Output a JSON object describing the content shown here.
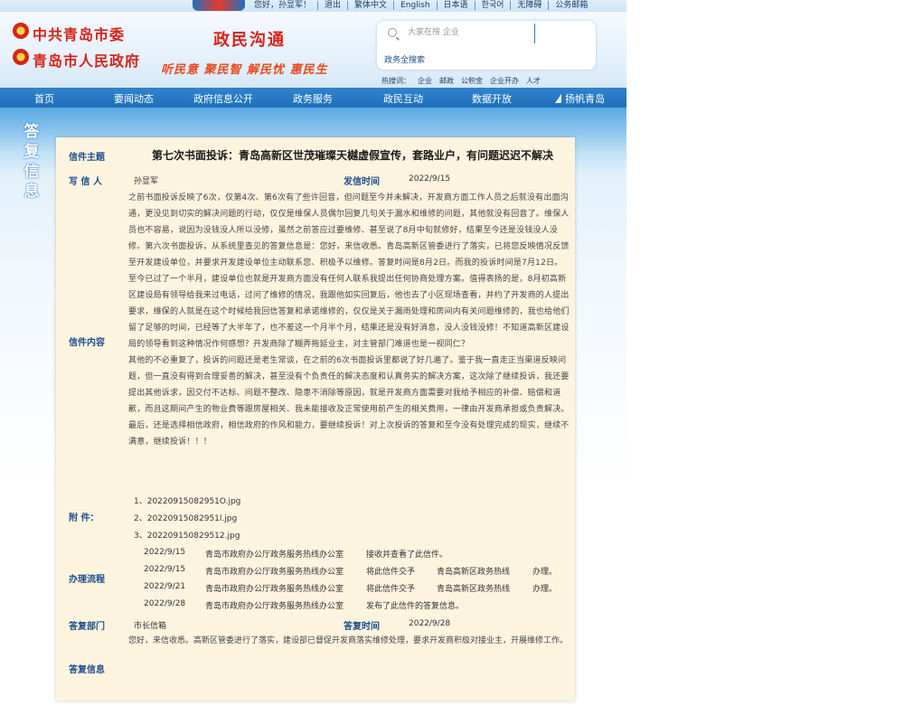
{
  "topbar": {
    "links": [
      "您好，孙显军！",
      "退出",
      "繁体中文",
      "English",
      "日本语",
      "한국어",
      "无障碍",
      "公务邮箱"
    ]
  },
  "header": {
    "party": "中共青岛市委",
    "gov": "青岛市人民政府",
    "slogan_main": "政民沟通",
    "slogan_sub": "听民意 聚民智 解民忧 惠民生",
    "search_placeholder": "大家在搜 企业",
    "search_scope": "政务全搜索",
    "hotwords_label": "热搜词：",
    "hotwords": [
      "企业",
      "邮政",
      "公积金",
      "企业开办",
      "人才"
    ]
  },
  "nav": {
    "items": [
      "首页",
      "要闻动态",
      "政府信息公开",
      "政务服务",
      "政民互动",
      "数据开放",
      "扬帆青岛"
    ]
  },
  "side_label": "答复信息",
  "letter": {
    "subject_label": "信件主题",
    "subject": "第七次书面投诉：青岛高新区世茂璀璨天樾虚假宣传，套路业户，有问题迟迟不解决",
    "writer_label": "写 信 人",
    "writer": "孙显军",
    "sent_label": "发信时间",
    "sent_date": "2022/9/15",
    "content_label": "信件内容",
    "content_paragraphs": [
      "之前书面投诉反映了6次，仅第4次、第6次有了些许回音，但问题至今并未解决，开发商方面工作人员之后就没有出面沟通，更没见到切实的解决问题的行动，仅仅是维保人员偶尔回复几句关于漏水和维修的问题，其他就没有回音了。维保人员也不容易，说因为没钱没人所以没修，虽然之前答应过要维修、甚至说了8月中旬就修好，结果至今还是没钱没人没修。第六次书面投诉，从系统里查见的答复信息是：您好，来信收悉。青岛高新区管委进行了落实，已将您反映情况反馈至开发建设单位，并要求开发建设单位主动联系您、积极予以维修。答复时间是8月2日。而我的投诉时间是7月12日。至今已过了一个半月，建设单位也就是开发商方面没有任何人联系我提出任何协商处理方案。值得表扬的是，8月初高新区建设局有领导给我来过电话，过问了维修的情况，我跟他如实回复后，他也去了小区现场查看，并约了开发商的人提出要求，维保的人就是在这个时候给我回信答复和承诺维修的，仅仅是关于漏雨处理和房间内有关问题维修的，我也给他们留了足够的时间，已经等了大半年了，也不差这一个月半个月，结果还是没有好消息，没人没钱没修！不知道高新区建设局的领导看到这种情况作何感想？开发商除了糊弄拖延业主，对主管部门难道也是一视同仁？",
      "其他的不必重复了，投诉的问题还是老生常谈，在之前的6次书面投诉里都说了好几遍了。鉴于我一直走正当渠道反映问题，但一直没有得到合理妥善的解决，甚至没有个负责任的解决态度和认真务实的解决方案，这次除了继续投诉，我还要提出其他诉求，因交付不达标、问题不整改、隐患不消除等原因，就是开发商方面需要对我给予相应的补偿、赔偿和道歉，而且这期间产生的物业费等跟房屋相关、我未能接收及正常使用前产生的相关费用，一律由开发商承担或负责解决。",
      "最后，还是选择相信政府，相信政府的作风和能力，要继续投诉！对上次投诉的答复和至今没有处理完成的现实，继续不满意，继续投诉！！！"
    ],
    "attach_label": "附  件：",
    "attachments": [
      "1、20220915082951O.jpg",
      "2、20220915082951l.jpg",
      "3、202209150829512.jpg"
    ],
    "flow_label": "办理流程",
    "flow": [
      {
        "date": "2022/9/15",
        "dept": "青岛市政府办公厅政务服务热线办公室",
        "action": "接收并查看了此信件。",
        "to": "",
        "suffix": ""
      },
      {
        "date": "2022/9/15",
        "dept": "青岛市政府办公厅政务服务热线办公室",
        "action": "将此信件交予",
        "to": "青岛高新区政务热线",
        "suffix": "办理。"
      },
      {
        "date": "2022/9/21",
        "dept": "青岛市政府办公厅政务服务热线办公室",
        "action": "将此信件交予",
        "to": "青岛高新区政务热线",
        "suffix": "办理。"
      },
      {
        "date": "2022/9/28",
        "dept": "青岛市政府办公厅政务服务热线办公室",
        "action": "发布了此信件的答复信息。",
        "to": "",
        "suffix": ""
      }
    ],
    "reply_dept_label": "答复部门",
    "reply_dept": "市长信箱",
    "reply_time_label": "答复时间",
    "reply_time": "2022/9/28",
    "reply_info_label": "答复信息",
    "reply_text": "您好，来信收悉。高新区管委进行了落实，建设部已督促开发商落实维修处理，要求开发商积极对接业主，开展维修工作。"
  }
}
